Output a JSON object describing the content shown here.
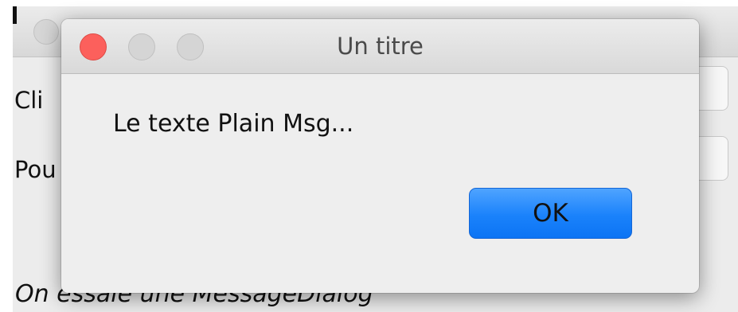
{
  "background_window": {
    "labels": [
      "Cli",
      "Pou"
    ],
    "status_text": "On essaie une MessageDialog"
  },
  "dialog": {
    "title": "Un titre",
    "message": "Le texte Plain Msg...",
    "ok_label": "OK"
  },
  "colors": {
    "close_button": "#fc605c",
    "ok_button": "#1a82fb"
  }
}
